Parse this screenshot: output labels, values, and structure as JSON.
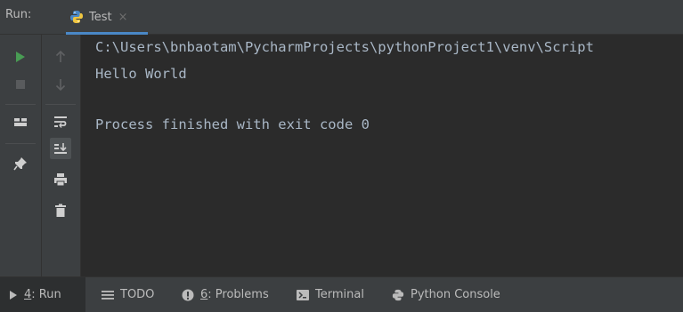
{
  "runbar": {
    "label": "Run:",
    "tab": {
      "label": "Test",
      "close": "×"
    }
  },
  "console": {
    "lines": [
      "C:\\Users\\bnbaotam\\PycharmProjects\\pythonProject1\\venv\\Script",
      "Hello World",
      "",
      "Process finished with exit code 0"
    ]
  },
  "bottom_tabs": [
    {
      "mnemonic": "4",
      "label": ": Run"
    },
    {
      "label": "TODO"
    },
    {
      "mnemonic": "6",
      "label": ": Problems"
    },
    {
      "label": "Terminal"
    },
    {
      "label": "Python Console"
    }
  ],
  "icons": {
    "rerun": "play-icon",
    "stop": "stop-icon",
    "up": "arrow-up-icon",
    "down": "arrow-down-icon",
    "layout": "layout-icon",
    "soft_wrap": "soft-wrap-icon",
    "scroll_end": "scroll-to-end-icon",
    "print": "print-icon",
    "delete": "trash-icon",
    "pin": "pin-icon"
  },
  "colors": {
    "accent": "#4a88c7",
    "run_green": "#499c54",
    "panel_bg": "#3c3f41",
    "console_bg": "#2b2b2b",
    "text": "#a9b7c6"
  }
}
